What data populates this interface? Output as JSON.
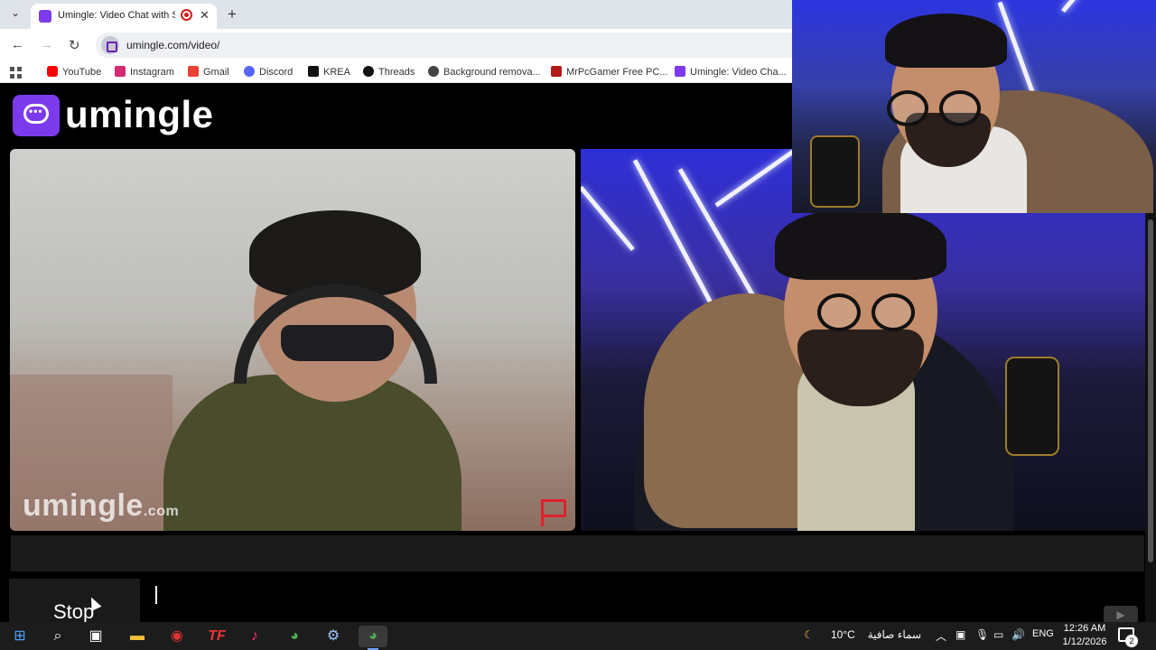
{
  "browser": {
    "tab": {
      "title": "Umingle: Video Chat with S"
    },
    "url": "umingle.com/video/",
    "bookmarks": [
      {
        "label": "YouTube",
        "color": "#ff0000"
      },
      {
        "label": "Instagram",
        "color": "#d62976"
      },
      {
        "label": "Gmail",
        "color": "#ea4335"
      },
      {
        "label": "Discord",
        "color": "#5865f2"
      },
      {
        "label": "KREA",
        "color": "#111111"
      },
      {
        "label": "Threads",
        "color": "#111111"
      },
      {
        "label": "Background remova...",
        "color": "#444444"
      },
      {
        "label": "MrPcGamer Free PC...",
        "color": "#b31b1b"
      },
      {
        "label": "Umingle: Video Cha...",
        "color": "#7c3aed"
      }
    ]
  },
  "page": {
    "brand": "umingle",
    "watermark": {
      "main": "umingle",
      "suffix": ".com"
    },
    "stop_label": "Stop",
    "accent": "#7c3aed"
  },
  "taskbar": {
    "weather": {
      "temp": "10°C",
      "desc": "سماء صافية"
    },
    "lang": "ENG",
    "time": "12:26 AM",
    "date": "1/12/2026",
    "notifications": "2"
  }
}
